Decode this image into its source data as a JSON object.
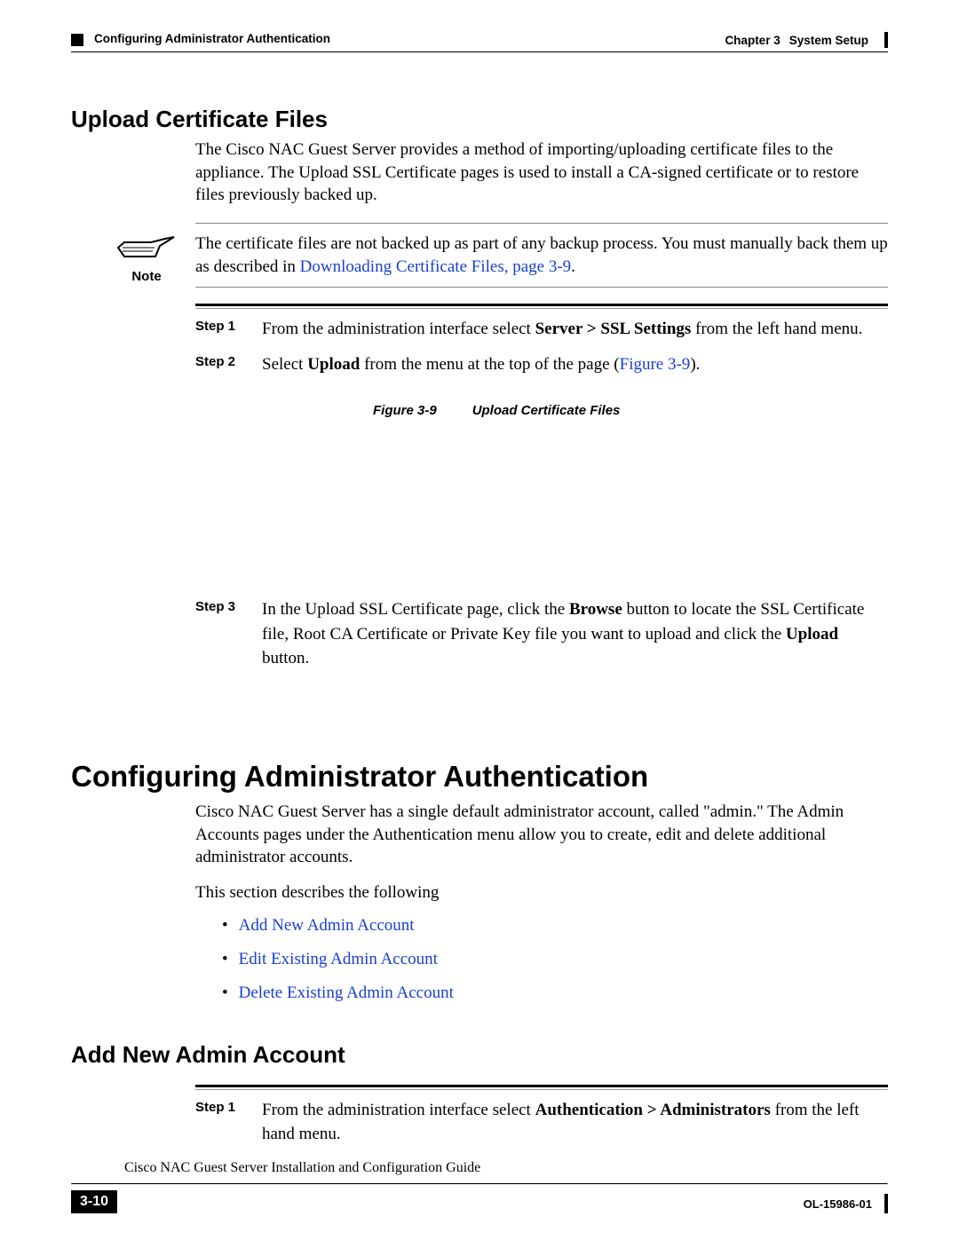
{
  "header": {
    "chapter_label": "Chapter 3",
    "chapter_title": "System Setup",
    "section_title": "Configuring Administrator Authentication"
  },
  "section1": {
    "heading": "Upload Certificate Files",
    "para1": "The Cisco NAC Guest Server provides a method of importing/uploading certificate files to the appliance. The Upload SSL Certificate pages is used to install a CA-signed certificate or to restore files previously backed up.",
    "note_label": "Note",
    "note_text_a": "The certificate files are not backed up as part of any backup process. You must manually back them up as described in ",
    "note_link": "Downloading Certificate Files, page 3-9",
    "note_text_b": ".",
    "step1_label": "Step 1",
    "step1_a": "From the administration interface select ",
    "step1_bold": "Server > SSL Settings",
    "step1_b": " from the left hand menu.",
    "step2_label": "Step 2",
    "step2_a": "Select ",
    "step2_bold": "Upload",
    "step2_b": " from the menu at the top of the page (",
    "step2_link": "Figure 3-9",
    "step2_c": ").",
    "fig_num": "Figure 3-9",
    "fig_title": "Upload Certificate Files",
    "step3_label": "Step 3",
    "step3_a": "In the Upload SSL Certificate page, click the ",
    "step3_bold1": "Browse",
    "step3_b": " button to locate the SSL Certificate file, Root CA Certificate or Private Key file you want to upload and click the ",
    "step3_bold2": "Upload",
    "step3_c": " button."
  },
  "section2": {
    "heading": "Configuring Administrator Authentication",
    "para1": "Cisco NAC Guest Server has a single default administrator account, called \"admin.\" The Admin Accounts pages under the Authentication menu allow you to create, edit and delete additional administrator accounts.",
    "para2": "This section describes the following",
    "link1": "Add New Admin Account",
    "link2": "Edit Existing Admin Account",
    "link3": "Delete Existing Admin Account"
  },
  "section3": {
    "heading": "Add New Admin Account",
    "step1_label": "Step 1",
    "step1_a": "From the administration interface select ",
    "step1_bold": "Authentication > Administrators",
    "step1_b": " from the left hand menu."
  },
  "footer": {
    "guide_title": "Cisco NAC Guest Server Installation and Configuration Guide",
    "page_number": "3-10",
    "doc_id": "OL-15986-01"
  }
}
